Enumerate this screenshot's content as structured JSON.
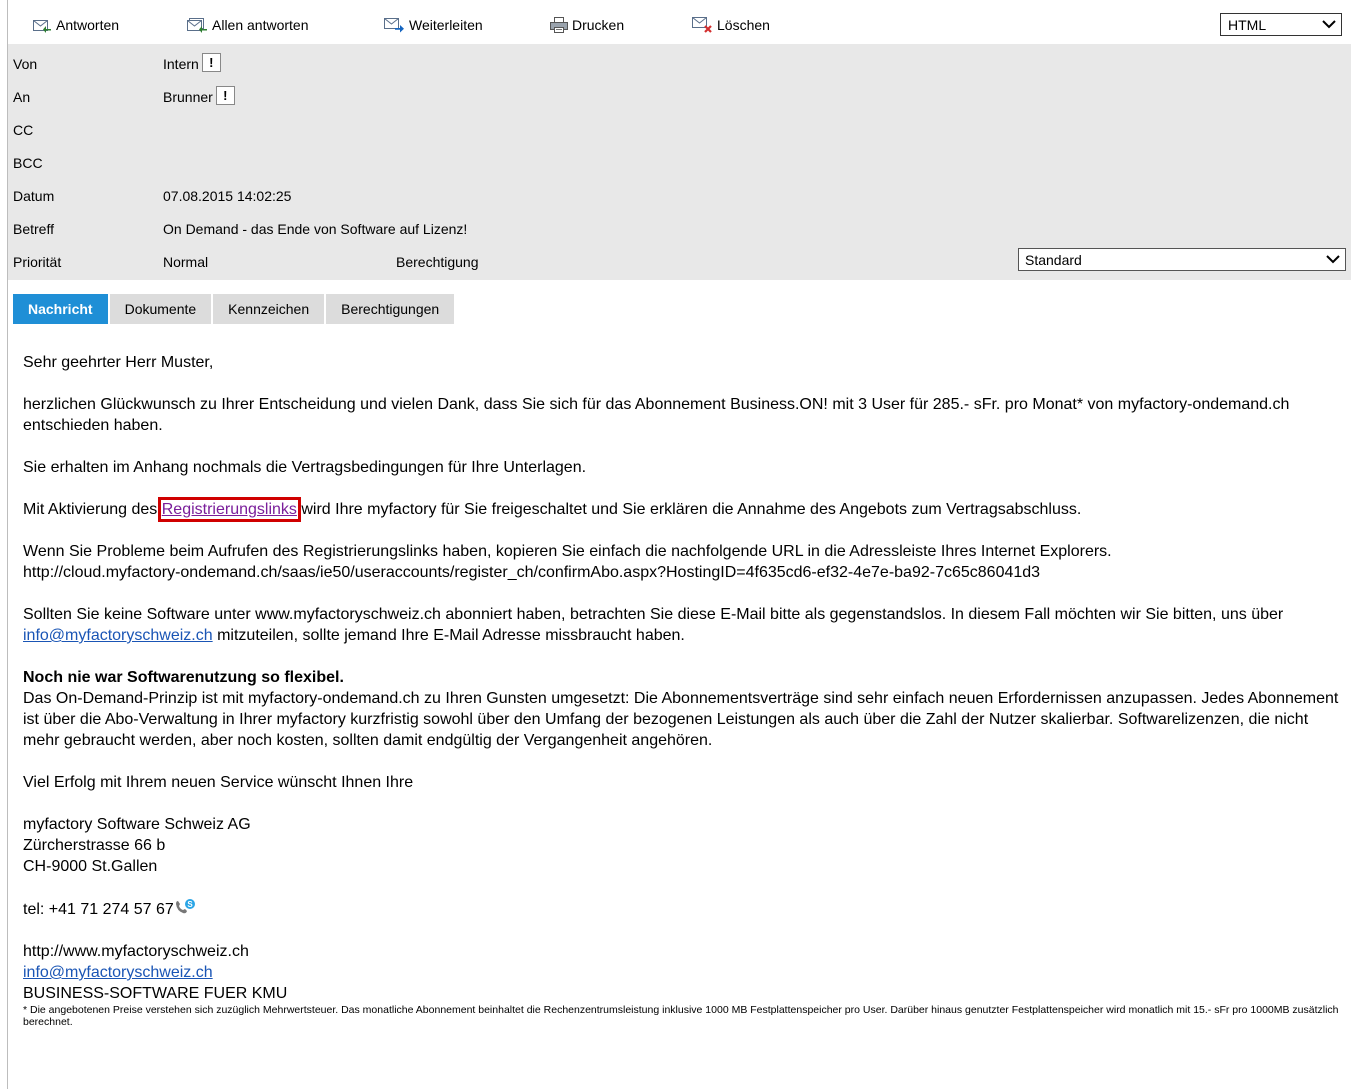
{
  "toolbar": {
    "reply_label": "Antworten",
    "reply_all_label": "Allen antworten",
    "forward_label": "Weiterleiten",
    "print_label": "Drucken",
    "delete_label": "Löschen",
    "format_value": "HTML"
  },
  "header": {
    "from_label": "Von",
    "from_value": "Intern",
    "to_label": "An",
    "to_value": "Brunner",
    "cc_label": "CC",
    "bcc_label": "BCC",
    "date_label": "Datum",
    "date_value": "07.08.2015 14:02:25",
    "subject_label": "Betreff",
    "subject_value": "On Demand - das Ende von Software auf Lizenz!",
    "priority_label": "Priorität",
    "priority_value": "Normal",
    "permission_label": "Berechtigung",
    "permission_value": "Standard",
    "importance_marker": "!"
  },
  "tabs": [
    {
      "label": "Nachricht",
      "active": true
    },
    {
      "label": "Dokumente",
      "active": false
    },
    {
      "label": "Kennzeichen",
      "active": false
    },
    {
      "label": "Berechtigungen",
      "active": false
    }
  ],
  "message": {
    "greeting": "Sehr geehrter Herr Muster,",
    "p1": "herzlichen Glückwunsch zu Ihrer Entscheidung und vielen Dank, dass Sie sich für das Abonnement Business.ON! mit 3 User für 285.- sFr. pro Monat* von myfactory-ondemand.ch entschieden haben.",
    "p2": "Sie erhalten im Anhang nochmals die Vertragsbedingungen für Ihre Unterlagen.",
    "p3_before": "Mit Aktivierung des ",
    "p3_link": "Registrierungslinks",
    "p3_after": " wird Ihre myfactory für Sie freigeschaltet und Sie erklären die Annahme des Angebots zum Vertragsabschluss.",
    "p4_line1": "Wenn Sie Probleme beim Aufrufen des Registrierungslinks haben, kopieren Sie einfach die nachfolgende URL in die Adressleiste Ihres Internet Explorers.",
    "p4_url": "http://cloud.myfactory-ondemand.ch/saas/ie50/useraccounts/register_ch/confirmAbo.aspx?HostingID=4f635cd6-ef32-4e7e-ba92-7c65c86041d3",
    "p5_before": "Sollten Sie keine Software unter www.myfactoryschweiz.ch abonniert haben, betrachten Sie diese E-Mail bitte als gegenstandslos. In diesem Fall möchten wir Sie bitten, uns über ",
    "p5_link": "info@myfactoryschweiz.ch",
    "p5_after": " mitzuteilen, sollte jemand Ihre E-Mail Adresse missbraucht haben.",
    "p6_heading": "Noch nie war Softwarenutzung so flexibel.",
    "p6_body": "Das On-Demand-Prinzip ist mit myfactory-ondemand.ch zu Ihren Gunsten umgesetzt: Die Abonnementsverträge sind sehr einfach neuen Erfordernissen anzupassen. Jedes Abonnement ist über die Abo-Verwaltung in Ihrer myfactory kurzfristig sowohl über den Umfang der bezogenen Leistungen als auch über die Zahl der Nutzer skalierbar. Softwarelizenzen, die nicht mehr gebraucht werden, aber noch kosten, sollten damit endgültig der Vergangenheit angehören.",
    "p7": "Viel Erfolg mit Ihrem neuen Service wünscht Ihnen Ihre",
    "company": "myfactory Software Schweiz AG",
    "street": "Zürcherstrasse 66 b",
    "city": "CH-9000 St.Gallen",
    "tel": "tel: +41 71 274 57 67",
    "website": "http://www.myfactoryschweiz.ch",
    "email_link": "info@myfactoryschweiz.ch",
    "tagline": "BUSINESS-SOFTWARE FUER KMU",
    "footnote": "* Die angebotenen Preise verstehen sich zuzüglich Mehrwertsteuer. Das monatliche Abonnement beinhaltet die Rechenzentrumsleistung inklusive 1000 MB Festplattenspeicher pro User. Darüber hinaus genutzter Festplattenspeicher wird monatlich mit 15.- sFr pro 1000MB zusätzlich berechnet."
  },
  "colors": {
    "tab_active": "#1f8fd6",
    "link": "#1a55b5",
    "highlight_box": "#d00000",
    "header_bg": "#e8e8e8"
  }
}
